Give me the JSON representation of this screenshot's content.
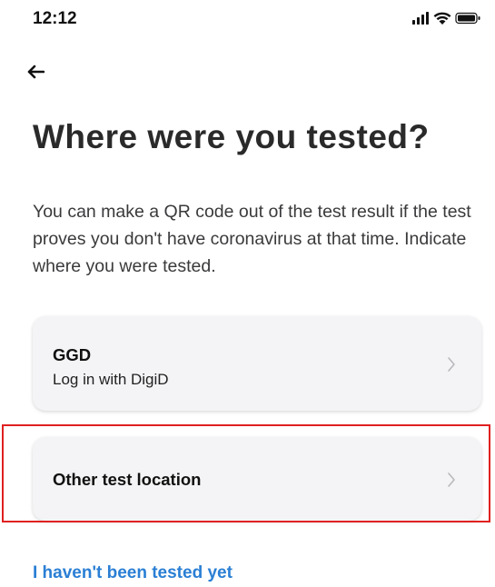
{
  "status_bar": {
    "time": "12:12",
    "signal_icon": "cellular-signal-icon",
    "wifi_icon": "wifi-icon",
    "battery_icon": "battery-icon"
  },
  "nav": {
    "back_icon": "arrow-left-icon"
  },
  "title": "Where were you tested?",
  "description": "You can make a QR code out of the test result if the test proves you don't have coronavirus at that time. Indicate where you were tested.",
  "options": [
    {
      "title": "GGD",
      "subtitle": "Log in with DigiD",
      "icon": "chevron-right-icon"
    },
    {
      "title": "Other test location",
      "icon": "chevron-right-icon"
    }
  ],
  "not_tested_link": "I haven't been tested yet",
  "colors": {
    "link": "#2a7fd4",
    "card_background": "#f4f4f6",
    "highlight": "#e02020"
  }
}
